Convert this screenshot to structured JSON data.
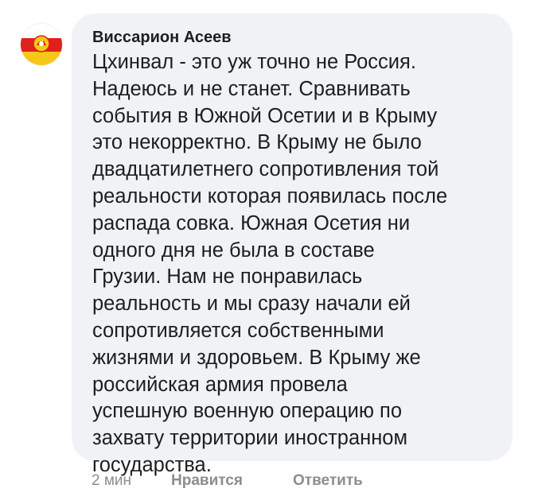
{
  "comment": {
    "author": "Виссарион Асеев",
    "lines": [
      "Цхинвал - это уж точно не Россия.",
      "Надеюсь и не станет. Сравнивать",
      "события в Южной Осетии и в Крыму",
      "это некорректно. В Крыму не было",
      "двадцатилетнего сопротивления той",
      "реальности которая появилась после",
      "распада совка. Южная Осетия ни",
      "одного дня не была в составе",
      "Грузии. Нам не понравилась",
      "реальность и мы сразу начали ей",
      "сопротивляется собственными",
      "жизнями и здоровьем. В Крыму же",
      "российская армия провела",
      "успешную военную операцию по",
      "захвату территории иностранном",
      "государства."
    ],
    "avatar_icon": "south-ossetia-flag-emblem-icon"
  },
  "actions": {
    "time": "2 мин",
    "like_label": "Нравится",
    "reply_label": "Ответить"
  },
  "colors": {
    "bubble": "#f0f2f5",
    "text": "#1c1e21",
    "secondary": "#8a8d91",
    "flag_white": "#ffffff",
    "flag_red": "#e0201b",
    "flag_yellow": "#f6c719"
  }
}
